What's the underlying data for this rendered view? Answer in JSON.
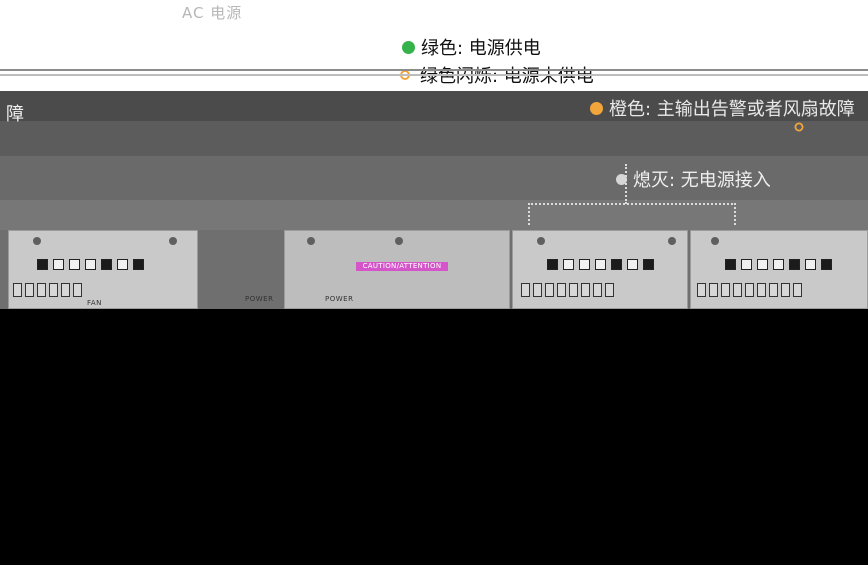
{
  "legend": {
    "header_partial": "AC 电源",
    "green_on": "绿色: 电源供电",
    "green_blink": "绿色闪烁: 电源未供电",
    "orange": "橙色: 主输出告警或者风扇故障",
    "off": "熄灭: 无电源接入",
    "left_partial": "障"
  },
  "labels": {
    "caution": "CAUTION/ATTENTION",
    "power_1": "POWER",
    "power_2": "POWER",
    "fan": "FAN"
  },
  "colors": {
    "green": "#35b24a",
    "orange": "#f2a53a",
    "caution": "#d455c9",
    "device": "#6f6f6f",
    "black": "#000000"
  }
}
